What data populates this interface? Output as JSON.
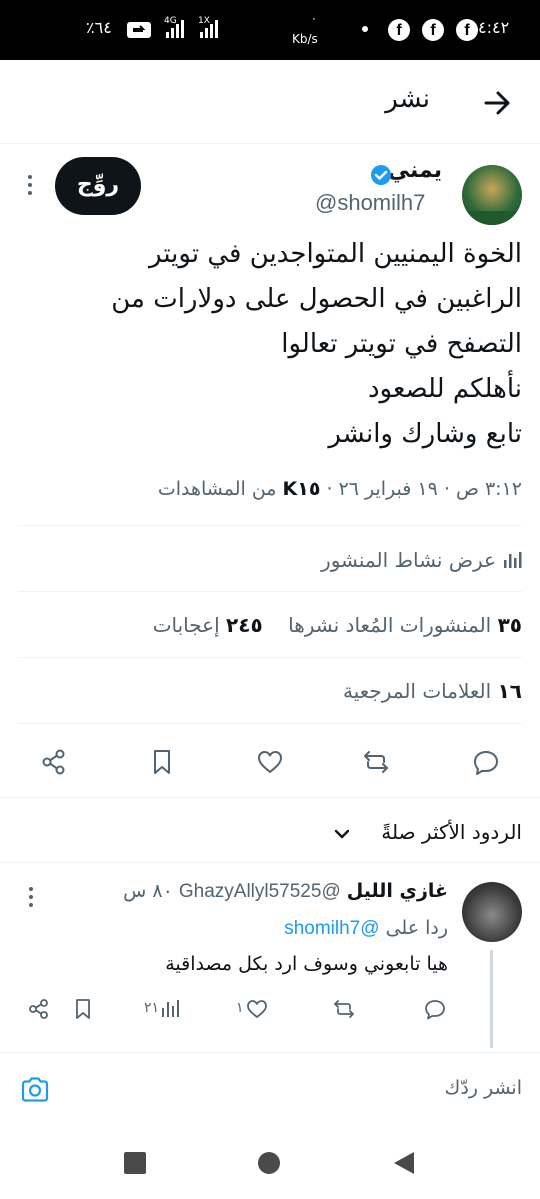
{
  "status_bar": {
    "time": "٤:٤٢",
    "net_speed": "Kb/s",
    "net_speed_value": "٠",
    "battery": "٪٦٤",
    "sim1": "4G",
    "sim2": "1X"
  },
  "header": {
    "title": "نشر"
  },
  "post": {
    "author_name": "يمني",
    "handle": "@shomilh7",
    "follow_label": "روِّج",
    "lines": [
      "الخوة اليمنيين المتواجدين في تويتر",
      "الراغبين في الحصول على دولارات من",
      "التصفح في تويتر تعالوا",
      "نأهلكم للصعود",
      "تابع وشارك وانشر"
    ],
    "meta_prefix": "٣:١٢ ص · ١٩ فبراير ٢٦ · ",
    "views": "K١٥",
    "meta_suffix": " من المشاهدات"
  },
  "activity": {
    "label": "عرض نشاط المنشور"
  },
  "stats": {
    "reposts_count": "٣٥",
    "reposts_label": "المنشورات المُعاد نشرها",
    "likes_count": "٢٤٥",
    "likes_label": "إعجابات",
    "bookmarks_count": "١٦",
    "bookmarks_label": "العلامات المرجعية"
  },
  "replies_sort": {
    "label": "الردود الأكثر صلةً"
  },
  "reply": {
    "name": "غازي الليل",
    "handle": "@GhazyAllyl57525",
    "time": "٨٠ س",
    "reply_to_label": "ردا على",
    "reply_to_mention": "@shomilh7",
    "text": "هيا تابعوني وسوف ارد بكل مصداقية",
    "views": "٢١",
    "likes": "١"
  },
  "compose": {
    "placeholder": "انشر ردّك"
  },
  "colors": {
    "accent": "#1d9bf0",
    "text": "#0f1419",
    "muted": "#536471",
    "divider": "#eff3f4"
  }
}
